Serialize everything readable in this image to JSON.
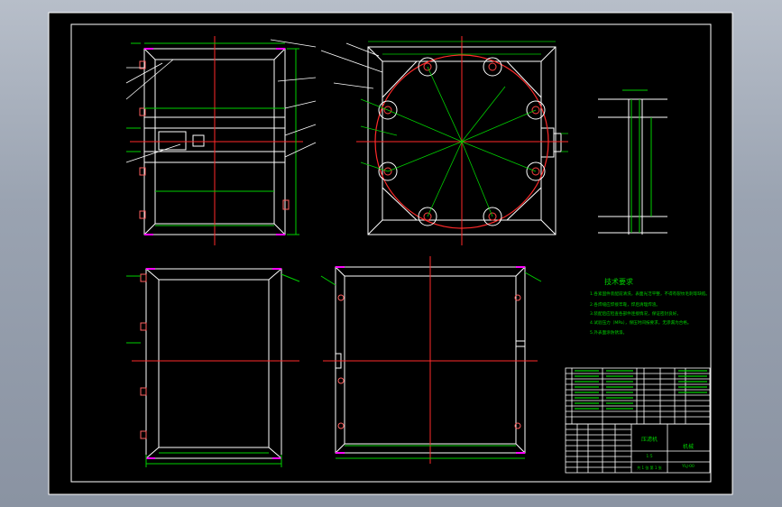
{
  "tech_requirements": {
    "title": "技术要求",
    "items": [
      "1.各紧固件装配前清洗，表面光洁平整，不得有裂纹毛刺等缺陷。",
      "2.各焊缝应焊接牢靠，焊后清理焊渣。",
      "3.装配后应检查各部件连接情况，保证密封良好。",
      "4.试验压力（MPa），保压时间按要求，无渗漏为合格。",
      "5.外表面涂防锈漆。"
    ]
  },
  "title_block": {
    "drawing_name": "压滤机",
    "company": "机械",
    "drawing_no": "YLJ-00",
    "scale": "1:5",
    "sheet": "共 1 张 第 1 张"
  },
  "colors": {
    "background": "#000000",
    "outline": "#ffffff",
    "centerline": "#ff2a2a",
    "dimension": "#00d000",
    "leader": "#ffffff",
    "accent": "#ff00ff",
    "hatch": "#ff0000"
  }
}
